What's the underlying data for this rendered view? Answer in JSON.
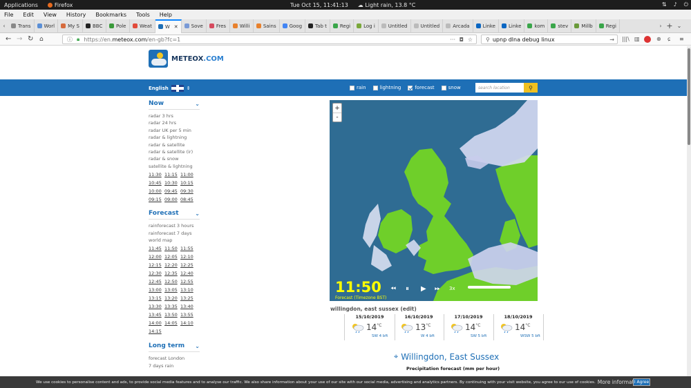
{
  "system_bar": {
    "applications": "Applications",
    "app": "Firefox",
    "datetime": "Tue Oct 15, 11:41:13",
    "weather": "Light rain, 13.8 °C"
  },
  "menu": [
    "File",
    "Edit",
    "View",
    "History",
    "Bookmarks",
    "Tools",
    "Help"
  ],
  "tabs": [
    {
      "label": "Trans",
      "color": "#888888"
    },
    {
      "label": "Worl",
      "color": "#5b8fd6"
    },
    {
      "label": "My S",
      "color": "#d66b3d"
    },
    {
      "label": "BBC",
      "color": "#222222"
    },
    {
      "label": "Pole",
      "color": "#3a9a3a"
    },
    {
      "label": "Weat",
      "color": "#e24b3b"
    },
    {
      "label": "W",
      "color": "#1e6fb6",
      "active": true
    },
    {
      "label": "Sove",
      "color": "#7a9ad6"
    },
    {
      "label": "Fres",
      "color": "#d64a5e"
    },
    {
      "label": "Willi",
      "color": "#e8812d"
    },
    {
      "label": "Sains",
      "color": "#e8812d"
    },
    {
      "label": "Goog",
      "color": "#4285f4"
    },
    {
      "label": "Tab t",
      "color": "#222222"
    },
    {
      "label": "Regi",
      "color": "#3aa64a"
    },
    {
      "label": "Log i",
      "color": "#7aa83a"
    },
    {
      "label": "Untitled",
      "color": "#bbbbbb"
    },
    {
      "label": "Untitled",
      "color": "#bbbbbb"
    },
    {
      "label": "Arcada",
      "color": "#bbbbbb"
    },
    {
      "label": "Linke",
      "color": "#0a66c2"
    },
    {
      "label": "Linke",
      "color": "#0a66c2"
    },
    {
      "label": "kom",
      "color": "#3aa64a"
    },
    {
      "label": "stev",
      "color": "#3aa64a"
    },
    {
      "label": "Millb",
      "color": "#6a9a3a"
    },
    {
      "label": "Regi",
      "color": "#3aa64a"
    }
  ],
  "nav": {
    "url_prefix": "https://en.",
    "url_domain": "meteox.com",
    "url_path": "/en-gb?fc=1",
    "search_value": "upnp dlna debug linux"
  },
  "site": {
    "logo_main": "METEOX",
    "logo_tld": ".COM",
    "language": "English",
    "filters": [
      {
        "label": "rain",
        "checked": false
      },
      {
        "label": "lightning",
        "checked": false
      },
      {
        "label": "forecast",
        "checked": true
      },
      {
        "label": "snow",
        "checked": false
      }
    ],
    "search_placeholder": "search location"
  },
  "sidebar": {
    "now": {
      "title": "Now",
      "links": [
        "radar 3 hrs",
        "radar 24 hrs",
        "radar UK per 5 min",
        "radar & lightning",
        "radar & satellite",
        "radar & satellite (ir)",
        "radar & snow",
        "satellite & lightning"
      ],
      "times": [
        "11:30",
        "11:15",
        "11:00",
        "10:45",
        "10:30",
        "10:15",
        "10:00",
        "09:45",
        "09:30",
        "09:15",
        "09:00",
        "08:45"
      ]
    },
    "forecast": {
      "title": "Forecast",
      "links": [
        "rainforecast 3 hours",
        "rainforecast 7 days",
        "world map"
      ],
      "times": [
        "11:45",
        "11:50",
        "11:55",
        "12:00",
        "12:05",
        "12:10",
        "12:15",
        "12:20",
        "12:25",
        "12:30",
        "12:35",
        "12:40",
        "12:45",
        "12:50",
        "12:55",
        "13:00",
        "13:05",
        "13:10",
        "13:15",
        "13:20",
        "13:25",
        "13:30",
        "13:35",
        "13:40",
        "13:45",
        "13:50",
        "13:55",
        "14:00",
        "14:05",
        "14:10",
        "14:15"
      ]
    },
    "longterm": {
      "title": "Long term",
      "links": [
        "forecast London",
        "7 days rain"
      ]
    }
  },
  "map": {
    "time": "11:50",
    "timezone": "Forecast (Timezone BST)",
    "speed": "3x",
    "zoom_in": "+",
    "zoom_out": "-"
  },
  "location_line": "willingdon, east sussex (edit)",
  "forecast": [
    {
      "date": "15/10/2019",
      "temp": "14",
      "unit": "°C",
      "wind": "SW 4 bft"
    },
    {
      "date": "16/10/2019",
      "temp": "13",
      "unit": "°C",
      "wind": "W 4 bft"
    },
    {
      "date": "17/10/2019",
      "temp": "14",
      "unit": "°C",
      "wind": "SW 5 bft"
    },
    {
      "date": "18/10/2019",
      "temp": "14",
      "unit": "°C",
      "wind": "WSW 5 bft"
    }
  ],
  "place_title": "Willingdon, East Sussex",
  "precip_title": "Precipitation forecast (mm per hour)",
  "cookie": {
    "text": "We use cookies to personalise content and ads, to provide social media features and to analyse our traffic. We also share information about your use of our site with our social media, advertising and analytics partners. By continuing with your visit website, you agree to our use of cookies.",
    "more": "More information",
    "agree": "I Agree"
  }
}
